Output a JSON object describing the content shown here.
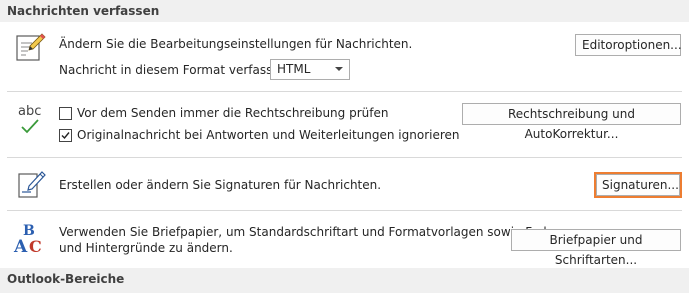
{
  "sections": {
    "compose_header": "Nachrichten verfassen",
    "outlook_header": "Outlook-Bereiche"
  },
  "editor": {
    "description": "Ändern Sie die Bearbeitungseinstellungen für Nachrichten.",
    "format_label": "Nachricht in diesem Format verfassen:",
    "format_value": "HTML",
    "editor_options_button": "Editoroptionen..."
  },
  "spelling": {
    "check_before_send_label": "Vor dem Senden immer die Rechtschreibung prüfen",
    "check_before_send_checked": false,
    "ignore_original_label": "Originalnachricht bei Antworten und Weiterleitungen ignorieren",
    "ignore_original_checked": true,
    "spelling_button": "Rechtschreibung und AutoKorrektur...",
    "abc_icon_text": "abc"
  },
  "signatures": {
    "description": "Erstellen oder ändern Sie Signaturen für Nachrichten.",
    "button": "Signaturen..."
  },
  "stationery": {
    "description_line1": "Verwenden Sie Briefpapier, um Standardschriftart und Formatvorlagen sowie Farben",
    "description_line2": "und Hintergründe zu ändern.",
    "button": "Briefpapier und Schriftarten..."
  },
  "colors": {
    "focus_accent": "#ed7d31",
    "header_bg": "#f0f0f0"
  }
}
